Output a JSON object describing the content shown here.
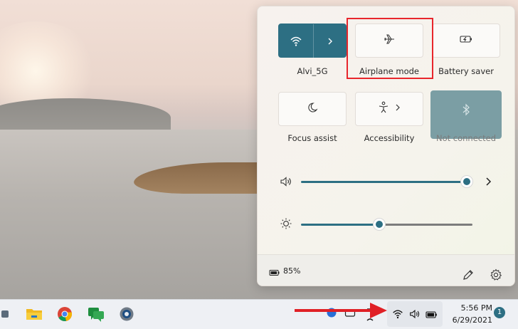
{
  "quick_settings": {
    "tiles": [
      {
        "label": "Alvi_5G",
        "icon": "wifi-icon",
        "state": "on"
      },
      {
        "label": "Airplane mode",
        "icon": "airplane-icon",
        "state": "off"
      },
      {
        "label": "Battery saver",
        "icon": "battery-saver-icon",
        "state": "off"
      },
      {
        "label": "Focus assist",
        "icon": "moon-icon",
        "state": "off"
      },
      {
        "label": "Accessibility",
        "icon": "accessibility-icon",
        "state": "off"
      },
      {
        "label": "Not connected",
        "icon": "bluetooth-icon",
        "state": "disabled"
      }
    ],
    "volume_level": 1.0,
    "brightness_level": 0.45,
    "battery": "85%"
  },
  "taskbar": {
    "apps": [
      "file-explorer-icon",
      "chrome-icon",
      "messages-icon",
      "settings-icon"
    ],
    "time": "5:56 PM",
    "date": "6/29/2021",
    "notifications": "1"
  },
  "colors": {
    "accent": "#2d6f83",
    "highlight": "#e8262c",
    "arrow": "#e02026"
  }
}
